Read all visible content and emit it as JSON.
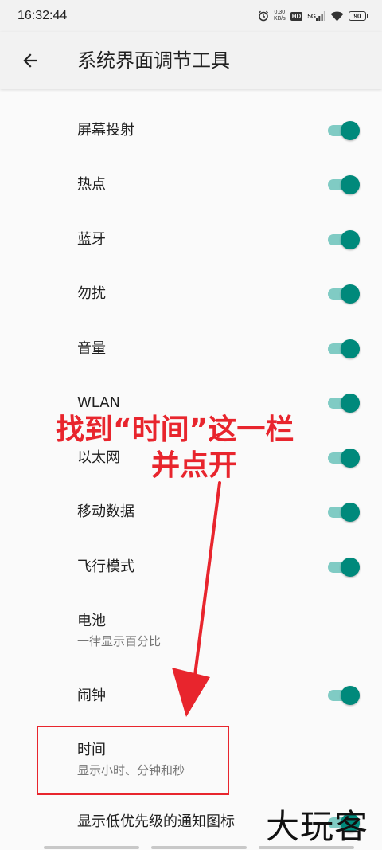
{
  "status_bar": {
    "time": "16:32:44",
    "net_speed_value": "0.30",
    "net_speed_unit": "KB/s",
    "hd_label": "HD",
    "network_label": "5G",
    "battery_level": "90",
    "icons": [
      "alarm-clock-icon",
      "signal-icon",
      "wifi-icon",
      "battery-icon"
    ]
  },
  "toolbar": {
    "title": "系统界面调节工具",
    "back_icon": "arrow-left-icon"
  },
  "settings": {
    "items": [
      {
        "label": "屏幕投射",
        "toggle": true
      },
      {
        "label": "热点",
        "toggle": true
      },
      {
        "label": "蓝牙",
        "toggle": true
      },
      {
        "label": "勿扰",
        "toggle": true
      },
      {
        "label": "音量",
        "toggle": true
      },
      {
        "label": "WLAN",
        "toggle": true
      },
      {
        "label": "以太网",
        "toggle": true
      },
      {
        "label": "移动数据",
        "toggle": true
      },
      {
        "label": "飞行模式",
        "toggle": true
      },
      {
        "label": "电池",
        "summary": "一律显示百分比"
      },
      {
        "label": "闹钟",
        "toggle": true
      },
      {
        "label": "时间",
        "summary": "显示小时、分钟和秒"
      },
      {
        "label": "显示低优先级的通知图标",
        "toggle": true
      }
    ]
  },
  "annotation": {
    "line1": "找到“时间”这一栏",
    "line2": "并点开",
    "color": "#e8252d"
  },
  "watermark": "大玩客",
  "colors": {
    "switch_thumb": "#00897b",
    "switch_track": "#80cbc4",
    "background": "#fafafa",
    "toolbar": "#f2f2f2"
  }
}
